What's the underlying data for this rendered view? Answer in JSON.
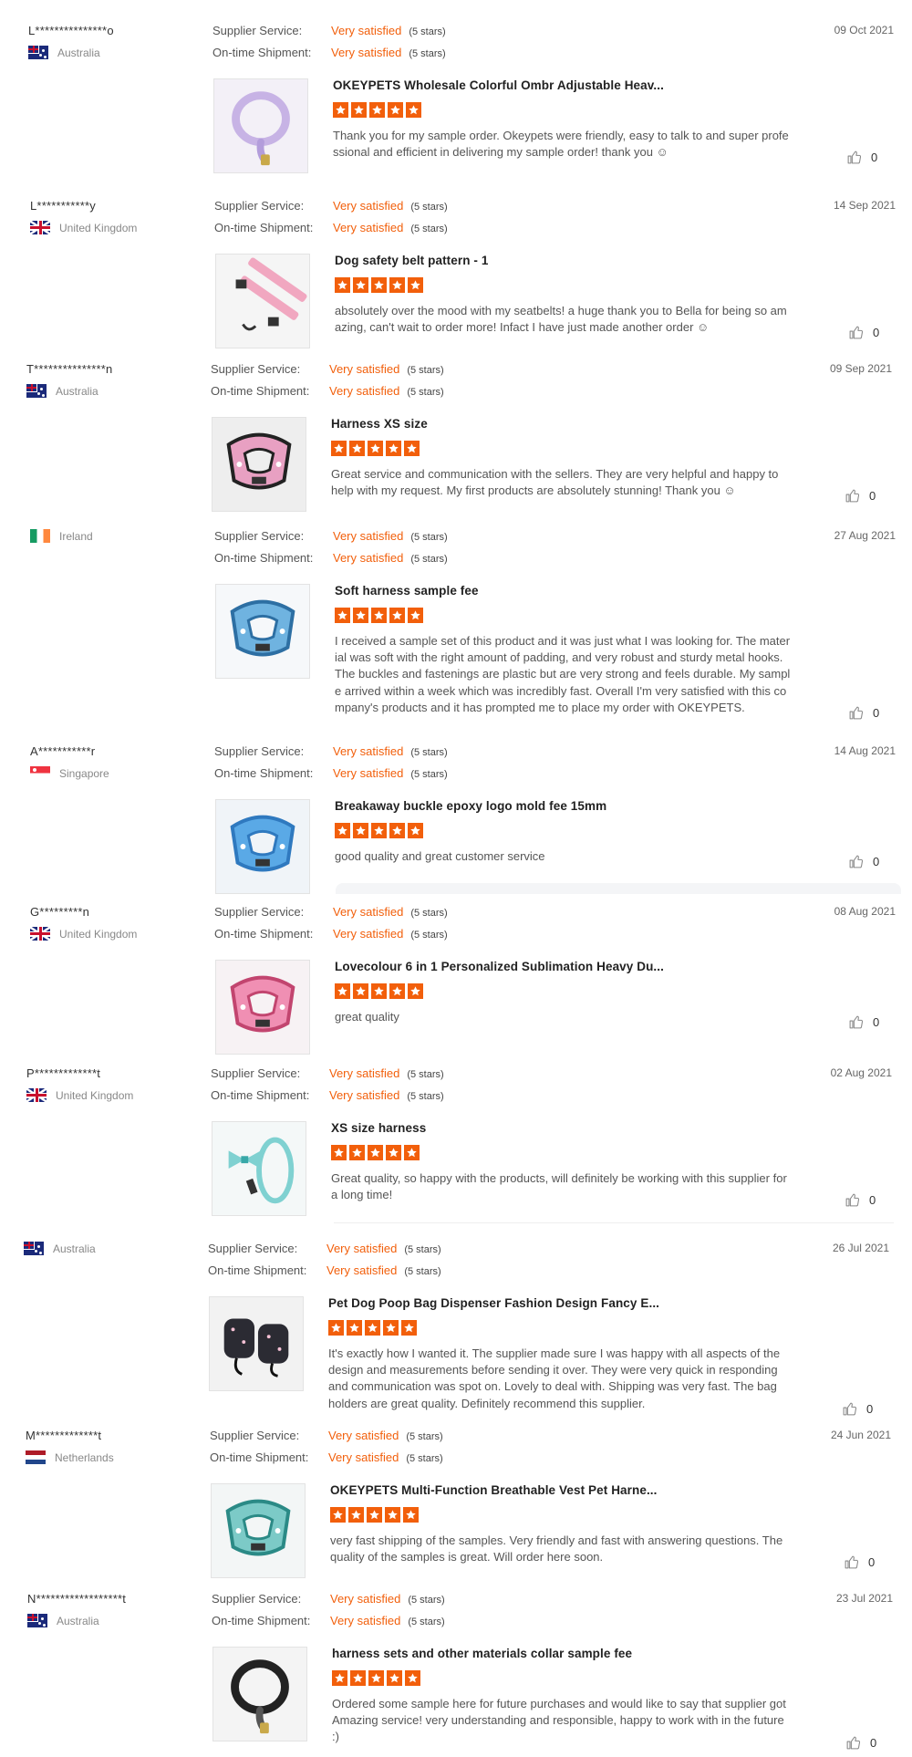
{
  "labels": {
    "supplier_service": "Supplier Service:",
    "ontime_shipment": "On-time Shipment:"
  },
  "colors": {
    "accent": "#f25f0b",
    "text": "#333333",
    "muted": "#888888"
  },
  "icons": {
    "star": "star-icon",
    "like": "thumbs-up-icon"
  },
  "reviews": [
    {
      "name": "L***************o",
      "country": "Australia",
      "flag": "au",
      "date": "09 Oct 2021",
      "supplier_service": "Very satisfied",
      "supplier_stars": "(5 stars)",
      "ontime": "Very satisfied",
      "ontime_stars": "(5 stars)",
      "product": "OKEYPETS Wholesale Colorful Ombr Adjustable Heav...",
      "rating": 5,
      "text": "Thank you for my sample order. Okeypets were friendly, easy to talk to and super professional and efficient in delivering my sample order! thank you ☺",
      "likes": "0"
    },
    {
      "name": "L***********y",
      "country": "United Kingdom",
      "flag": "uk",
      "date": "14 Sep 2021",
      "supplier_service": "Very satisfied",
      "supplier_stars": "(5 stars)",
      "ontime": "Very satisfied",
      "ontime_stars": "(5 stars)",
      "product": "Dog safety belt pattern - 1",
      "rating": 5,
      "text": "absolutely over the mood with my seatbelts! a huge thank you to Bella for being so amazing, can't wait to order more! Infact I have just made another order ☺",
      "likes": "0"
    },
    {
      "name": "T***************n",
      "country": "Australia",
      "flag": "au",
      "date": "09 Sep 2021",
      "supplier_service": "Very satisfied",
      "supplier_stars": "(5 stars)",
      "ontime": "Very satisfied",
      "ontime_stars": "(5 stars)",
      "product": "Harness XS size",
      "rating": 5,
      "text": "Great service and communication with the sellers. They are very helpful and happy to help with my request. My first products are absolutely stunning! Thank you ☺",
      "likes": "0"
    },
    {
      "name": "",
      "country": "Ireland",
      "flag": "ie",
      "date": "27 Aug 2021",
      "supplier_service": "Very satisfied",
      "supplier_stars": "(5 stars)",
      "ontime": "Very satisfied",
      "ontime_stars": "(5 stars)",
      "product": "Soft harness sample fee",
      "rating": 5,
      "text": "I received a sample set of this product and it was just what I was looking for. The material was soft with the right amount of padding, and very robust and sturdy metal hooks. The buckles and fastenings are plastic but are very strong and feels durable. My sample arrived within a week which was incredibly fast. Overall I'm very satisfied with this company's products and it has prompted me to place my order with OKEYPETS.",
      "likes": "0"
    },
    {
      "name": "A***********r",
      "country": "Singapore",
      "flag": "sg",
      "date": "14 Aug 2021",
      "supplier_service": "Very satisfied",
      "supplier_stars": "(5 stars)",
      "ontime": "Very satisfied",
      "ontime_stars": "(5 stars)",
      "product": "Breakaway buckle epoxy logo mold fee 15mm",
      "rating": 5,
      "text": "good quality and great customer service",
      "likes": "0"
    },
    {
      "name": "G*********n",
      "country": "United Kingdom",
      "flag": "uk",
      "date": "08 Aug 2021",
      "supplier_service": "Very satisfied",
      "supplier_stars": "(5 stars)",
      "ontime": "Very satisfied",
      "ontime_stars": "(5 stars)",
      "product": "Lovecolour 6 in 1 Personalized Sublimation Heavy Du...",
      "rating": 5,
      "text": "great quality",
      "likes": "0"
    },
    {
      "name": "P*************t",
      "country": "United Kingdom",
      "flag": "uk",
      "date": "02 Aug 2021",
      "supplier_service": "Very satisfied",
      "supplier_stars": "(5 stars)",
      "ontime": "Very satisfied",
      "ontime_stars": "(5 stars)",
      "product": "XS size harness",
      "rating": 5,
      "text": "Great quality, so happy with the products, will definitely be working with this supplier for a long time!",
      "likes": "0"
    },
    {
      "name": "",
      "country": "Australia",
      "flag": "au",
      "date": "26 Jul 2021",
      "supplier_service": "Very satisfied",
      "supplier_stars": "(5 stars)",
      "ontime": "Very satisfied",
      "ontime_stars": "(5 stars)",
      "product": "Pet Dog Poop Bag Dispenser Fashion Design Fancy E...",
      "rating": 5,
      "text": "It's exactly how I wanted it. The supplier made sure I was happy with all aspects of the design and measurements before sending it over. They were very quick in responding and communication was spot on. Lovely to deal with. Shipping was very fast. The bag holders are great quality. Definitely recommend this supplier.",
      "likes": "0"
    },
    {
      "name": "M*************t",
      "country": "Netherlands",
      "flag": "nl",
      "date": "24 Jun 2021",
      "supplier_service": "Very satisfied",
      "supplier_stars": "(5 stars)",
      "ontime": "Very satisfied",
      "ontime_stars": "(5 stars)",
      "product": "OKEYPETS Multi-Function Breathable Vest Pet Harne...",
      "rating": 5,
      "text": "very fast shipping of the samples. Very friendly and fast with answering questions. The quality of the samples is great. Will order here soon.",
      "likes": "0"
    },
    {
      "name": "N******************t",
      "country": "Australia",
      "flag": "au",
      "date": "23 Jul 2021",
      "supplier_service": "Very satisfied",
      "supplier_stars": "(5 stars)",
      "ontime": "Very satisfied",
      "ontime_stars": "(5 stars)",
      "product": "harness sets and other materials collar sample fee",
      "rating": 5,
      "text": "Ordered some sample here for future purchases and would like to say that supplier got Amazing service! very understanding and responsible, happy to work with in the future :)",
      "likes": "0"
    }
  ]
}
